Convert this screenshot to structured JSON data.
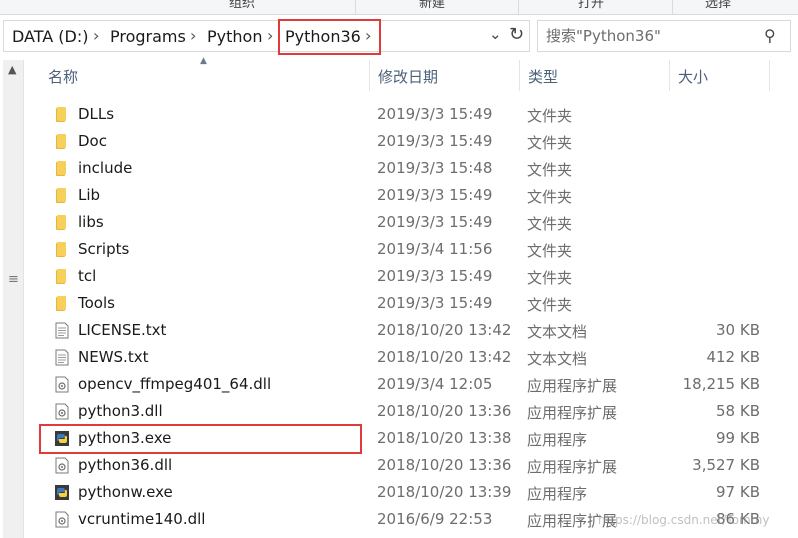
{
  "ribbon": {
    "labels": [
      "组织",
      "新建",
      "打开",
      "选择"
    ]
  },
  "address": {
    "crumbs": [
      "DATA (D:)",
      "Programs",
      "Python",
      "Python36"
    ]
  },
  "search": {
    "placeholder": "搜索\"Python36\""
  },
  "columns": {
    "name": "名称",
    "date": "修改日期",
    "type": "类型",
    "size": "大小"
  },
  "files": [
    {
      "name": "DLLs",
      "date": "2019/3/3 15:49",
      "type": "文件夹",
      "size": "",
      "icon": "folder-icon"
    },
    {
      "name": "Doc",
      "date": "2019/3/3 15:49",
      "type": "文件夹",
      "size": "",
      "icon": "folder-icon"
    },
    {
      "name": "include",
      "date": "2019/3/3 15:48",
      "type": "文件夹",
      "size": "",
      "icon": "folder-icon"
    },
    {
      "name": "Lib",
      "date": "2019/3/3 15:49",
      "type": "文件夹",
      "size": "",
      "icon": "folder-icon"
    },
    {
      "name": "libs",
      "date": "2019/3/3 15:49",
      "type": "文件夹",
      "size": "",
      "icon": "folder-icon"
    },
    {
      "name": "Scripts",
      "date": "2019/3/4 11:56",
      "type": "文件夹",
      "size": "",
      "icon": "folder-icon"
    },
    {
      "name": "tcl",
      "date": "2019/3/3 15:49",
      "type": "文件夹",
      "size": "",
      "icon": "folder-icon"
    },
    {
      "name": "Tools",
      "date": "2019/3/3 15:49",
      "type": "文件夹",
      "size": "",
      "icon": "folder-icon"
    },
    {
      "name": "LICENSE.txt",
      "date": "2018/10/20 13:42",
      "type": "文本文档",
      "size": "30 KB",
      "icon": "text-file-icon"
    },
    {
      "name": "NEWS.txt",
      "date": "2018/10/20 13:42",
      "type": "文本文档",
      "size": "412 KB",
      "icon": "text-file-icon"
    },
    {
      "name": "opencv_ffmpeg401_64.dll",
      "date": "2019/3/4 12:05",
      "type": "应用程序扩展",
      "size": "18,215 KB",
      "icon": "dll-file-icon"
    },
    {
      "name": "python3.dll",
      "date": "2018/10/20 13:36",
      "type": "应用程序扩展",
      "size": "58 KB",
      "icon": "dll-file-icon"
    },
    {
      "name": "python3.exe",
      "date": "2018/10/20 13:38",
      "type": "应用程序",
      "size": "99 KB",
      "icon": "python-exe-icon"
    },
    {
      "name": "python36.dll",
      "date": "2018/10/20 13:36",
      "type": "应用程序扩展",
      "size": "3,527 KB",
      "icon": "dll-file-icon"
    },
    {
      "name": "pythonw.exe",
      "date": "2018/10/20 13:39",
      "type": "应用程序",
      "size": "97 KB",
      "icon": "python-exe-icon"
    },
    {
      "name": "vcruntime140.dll",
      "date": "2016/6/9 22:53",
      "type": "应用程序扩展",
      "size": "86 KB",
      "icon": "dll-file-icon"
    }
  ],
  "watermark": "https://blog.csdn.net/Tommy",
  "colors": {
    "highlight": "#e03a3a",
    "folder": "#f0c24a",
    "header_text": "#4c607a"
  }
}
